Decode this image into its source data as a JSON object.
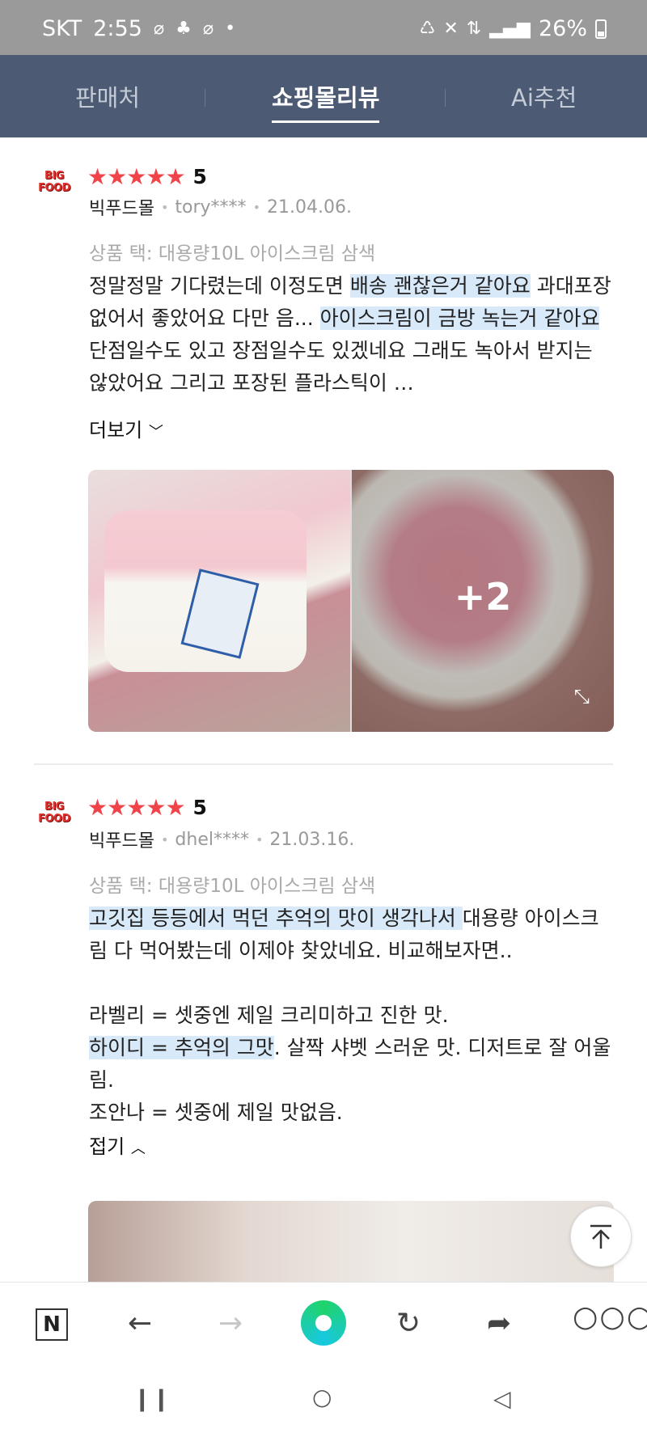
{
  "status_bar": {
    "carrier": "SKT",
    "time": "2:55",
    "battery": "26%"
  },
  "tabs": [
    {
      "label": "판매처",
      "active": false
    },
    {
      "label": "쇼핑몰리뷰",
      "active": true
    },
    {
      "label": "Ai추천",
      "active": false
    }
  ],
  "reviews": [
    {
      "logo_text": [
        "BIG",
        "FOOD"
      ],
      "stars": 5,
      "score": "5",
      "mall": "빅푸드몰",
      "user": "tory****",
      "date": "21.04.06.",
      "tag": "상품 택: 대용량10L 아이스크림 삼색",
      "body": [
        {
          "t": "정말정말 기다렸는데 이정도면 "
        },
        {
          "t": "배송 괜찮은거 같아요",
          "hl": true
        },
        {
          "t": " 과대포장 없어서 좋았어요 다만 음... "
        },
        {
          "t": "아이스크림이 금방 녹는거 같아요",
          "hl": true
        },
        {
          "t": " 단점일수도 있고 장점일수도 있겠네요 그래도 녹아서 받지는 않았어요 그리고 포장된 플라스틱이 …"
        }
      ],
      "toggle_label": "더보기",
      "toggle_icon": "chevron-down-icon",
      "photo_more": "+2"
    },
    {
      "logo_text": [
        "BIG",
        "FOOD"
      ],
      "stars": 5,
      "score": "5",
      "mall": "빅푸드몰",
      "user": "dhel****",
      "date": "21.03.16.",
      "tag": "상품 택: 대용량10L 아이스크림 삼색",
      "paragraphs": [
        [
          {
            "t": "고깃집 등등에서 먹던 추억의 맛이 생각나서 ",
            "hl": true
          },
          {
            "t": "대용량 아이스크림 다 먹어봤는데 이제야 찾았네요. 비교해보자면.."
          }
        ],
        [],
        [
          {
            "t": "라벨리 = 셋중엔 제일 크리미하고 진한 맛."
          }
        ],
        [
          {
            "t": "하이디 = 추억의 그맛",
            "hl": true
          },
          {
            "t": ". 살짝 샤벳 스러운 맛. 디저트로 잘 어울림."
          }
        ],
        [
          {
            "t": "조안나 = 셋중에 제일 맛없음."
          }
        ]
      ],
      "toggle_label": "접기",
      "toggle_icon": "chevron-up-icon"
    }
  ],
  "toolbar": {
    "items": [
      "naver-home",
      "back",
      "forward",
      "green-dot",
      "refresh",
      "share",
      "more"
    ]
  },
  "colors": {
    "tabbar": "#4c5a73",
    "star": "#f0434a",
    "highlight": "#d8e9f9"
  }
}
